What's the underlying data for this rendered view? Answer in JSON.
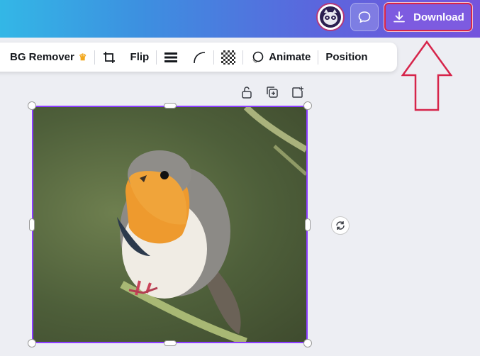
{
  "topbar": {
    "download_label": "Download"
  },
  "toolbar": {
    "bg_remover_label": "BG Remover",
    "flip_label": "Flip",
    "animate_label": "Animate",
    "position_label": "Position"
  },
  "icons": {
    "crown": "crown-icon",
    "crop": "crop-icon",
    "border": "border-style-icon",
    "corner": "corner-rounding-icon",
    "transparency": "transparency-icon",
    "animate": "animate-icon",
    "lock": "lock-icon",
    "duplicate": "duplicate-icon",
    "add": "add-page-icon",
    "rotate": "rotate-icon",
    "comment": "comment-icon",
    "download": "download-icon"
  },
  "colors": {
    "selection": "#8b3dff",
    "annotation": "#d6244a",
    "crown": "#f2a71b"
  },
  "canvas": {
    "image": "robin-photo"
  }
}
